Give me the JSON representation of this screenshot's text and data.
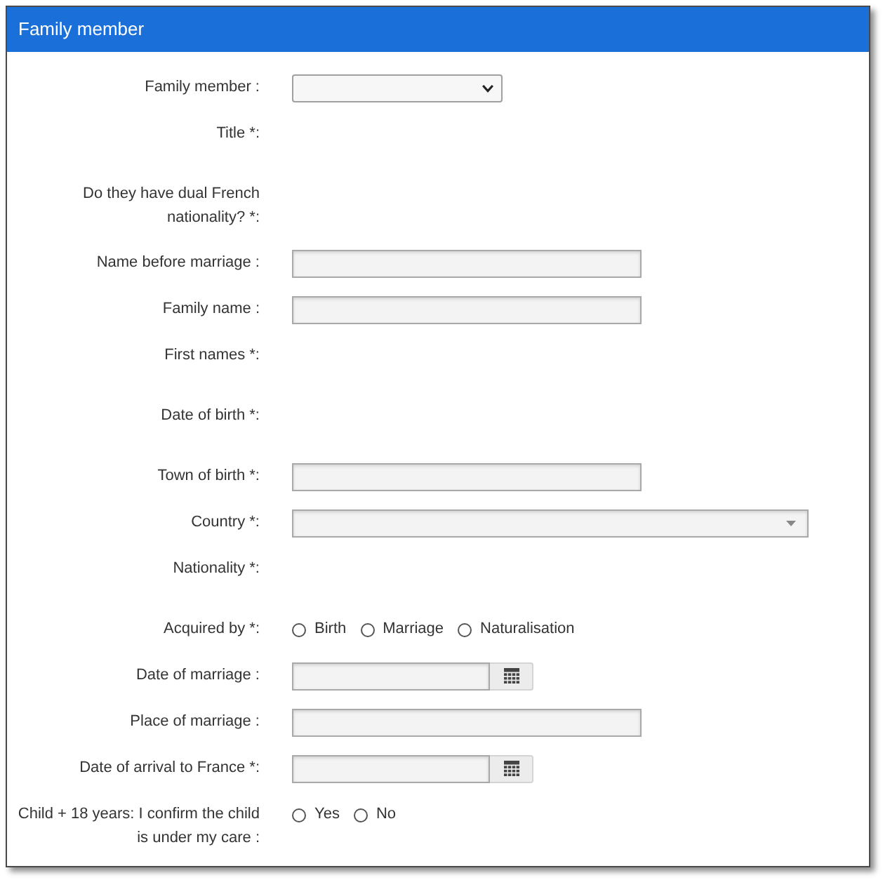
{
  "panel": {
    "title": "Family member"
  },
  "fields": [
    {
      "label": "Family member :",
      "kind": "select"
    },
    {
      "label": "Title *:",
      "kind": "label"
    },
    {
      "label": "Do they have dual French nationality? *:",
      "kind": "label"
    },
    {
      "label": "Name before marriage :",
      "kind": "text"
    },
    {
      "label": "Family name :",
      "kind": "text"
    },
    {
      "label": "First names *:",
      "kind": "label"
    },
    {
      "label": "Date of birth *:",
      "kind": "label"
    },
    {
      "label": "Town of birth *:",
      "kind": "text"
    },
    {
      "label": "Country *:",
      "kind": "combobox"
    },
    {
      "label": "Nationality *:",
      "kind": "label"
    },
    {
      "label": "Acquired by *:",
      "kind": "radio",
      "options": [
        {
          "label": "Birth",
          "selected": false
        },
        {
          "label": "Marriage",
          "selected": false
        },
        {
          "label": "Naturalisation",
          "selected": false
        }
      ]
    },
    {
      "label": "Date of marriage :",
      "kind": "date"
    },
    {
      "label": "Place of marriage :",
      "kind": "text"
    },
    {
      "label": "Date of arrival to France *:",
      "kind": "date"
    },
    {
      "label": "Child + 18 years: I confirm the child is under my care :",
      "kind": "radio",
      "options": [
        {
          "label": "Yes",
          "selected": false
        },
        {
          "label": "No",
          "selected": false
        }
      ]
    }
  ]
}
